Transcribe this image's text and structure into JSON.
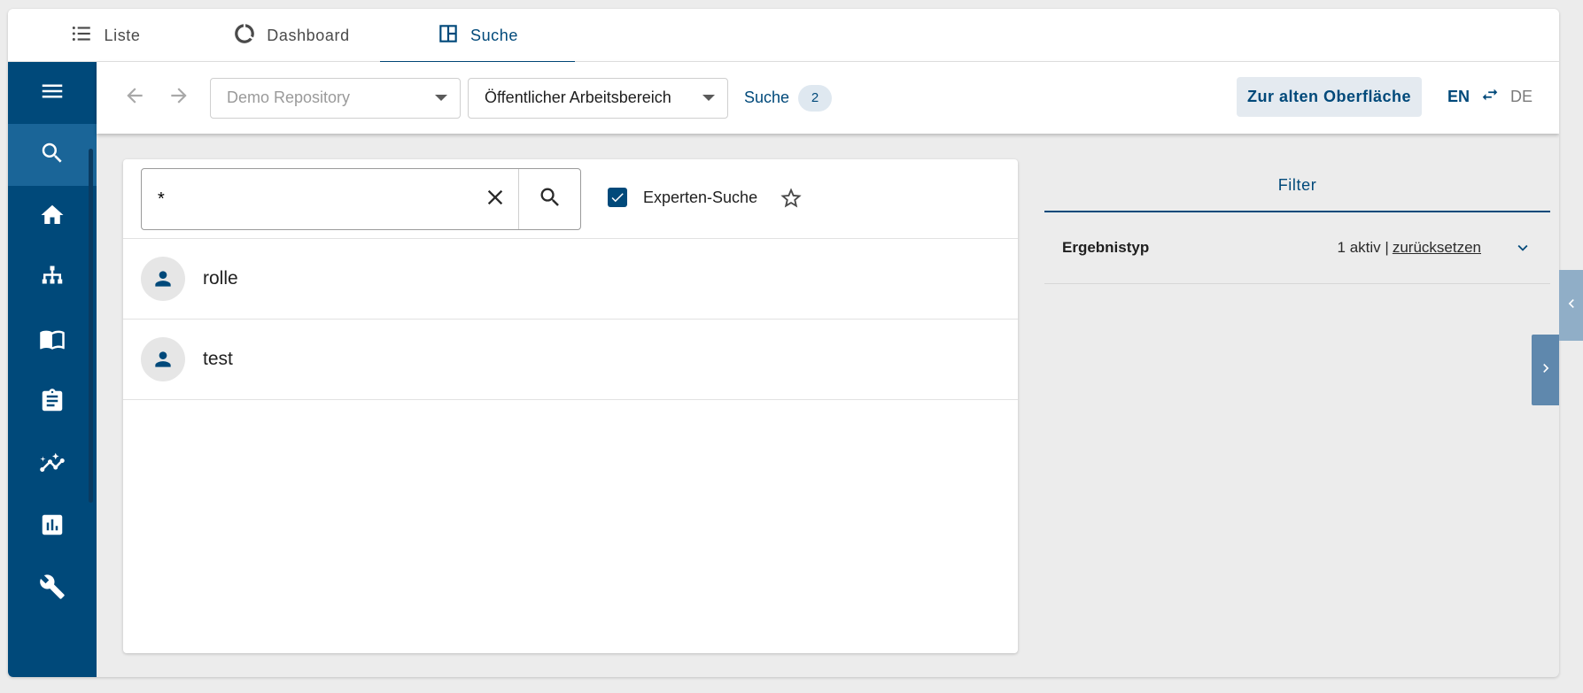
{
  "tabs": [
    {
      "label": "Liste",
      "icon": "list-icon"
    },
    {
      "label": "Dashboard",
      "icon": "donut-icon"
    },
    {
      "label": "Suche",
      "icon": "layout-icon",
      "active": true
    }
  ],
  "sidebar": {
    "items": [
      {
        "icon": "menu-icon"
      },
      {
        "icon": "search-icon",
        "active": true
      },
      {
        "icon": "home-icon"
      },
      {
        "icon": "sitemap-icon"
      },
      {
        "icon": "book-icon"
      },
      {
        "icon": "clipboard-icon"
      },
      {
        "icon": "insights-icon"
      },
      {
        "icon": "bar-chart-icon"
      },
      {
        "icon": "wrench-icon"
      }
    ]
  },
  "toolbar": {
    "repository": "Demo Repository",
    "workspace": "Öffentlicher Arbeitsbereich",
    "search_label": "Suche",
    "search_count": "2",
    "old_ui_label": "Zur alten Oberfläche",
    "lang_en": "EN",
    "lang_de": "DE"
  },
  "search": {
    "query": "*",
    "expert_label": "Experten-Suche",
    "expert_checked": true
  },
  "results": [
    {
      "label": "rolle"
    },
    {
      "label": "test"
    }
  ],
  "filter": {
    "title": "Filter",
    "rows": [
      {
        "name": "Ergebnistyp",
        "active_text": "1 aktiv |",
        "reset_label": "zurücksetzen"
      }
    ]
  },
  "colors": {
    "primary": "#00497a",
    "sidebar_active": "#1a6598",
    "background": "#ececec"
  }
}
